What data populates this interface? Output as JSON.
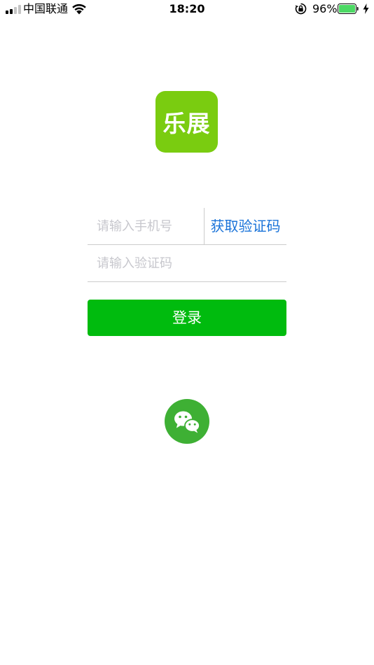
{
  "status_bar": {
    "carrier": "中国联通",
    "time": "18:20",
    "battery_percent": "96%",
    "battery_level": 0.96,
    "signal_bars_filled": 2,
    "signal_bars_total": 4,
    "icons": [
      "signal-icon",
      "wifi-icon",
      "rotation-lock-icon",
      "battery-icon",
      "charging-icon"
    ]
  },
  "app": {
    "logo_text": "乐展",
    "logo_color": "#7acc10"
  },
  "login_form": {
    "phone_placeholder": "请输入手机号",
    "phone_value": "",
    "get_code_label": "获取验证码",
    "code_placeholder": "请输入验证码",
    "code_value": "",
    "login_label": "登录"
  },
  "colors": {
    "primary_button": "#00bb0e",
    "link": "#1a73d9",
    "wechat": "#3eb034",
    "battery": "#4cd964"
  },
  "third_party_login": {
    "icon": "wechat-icon"
  }
}
